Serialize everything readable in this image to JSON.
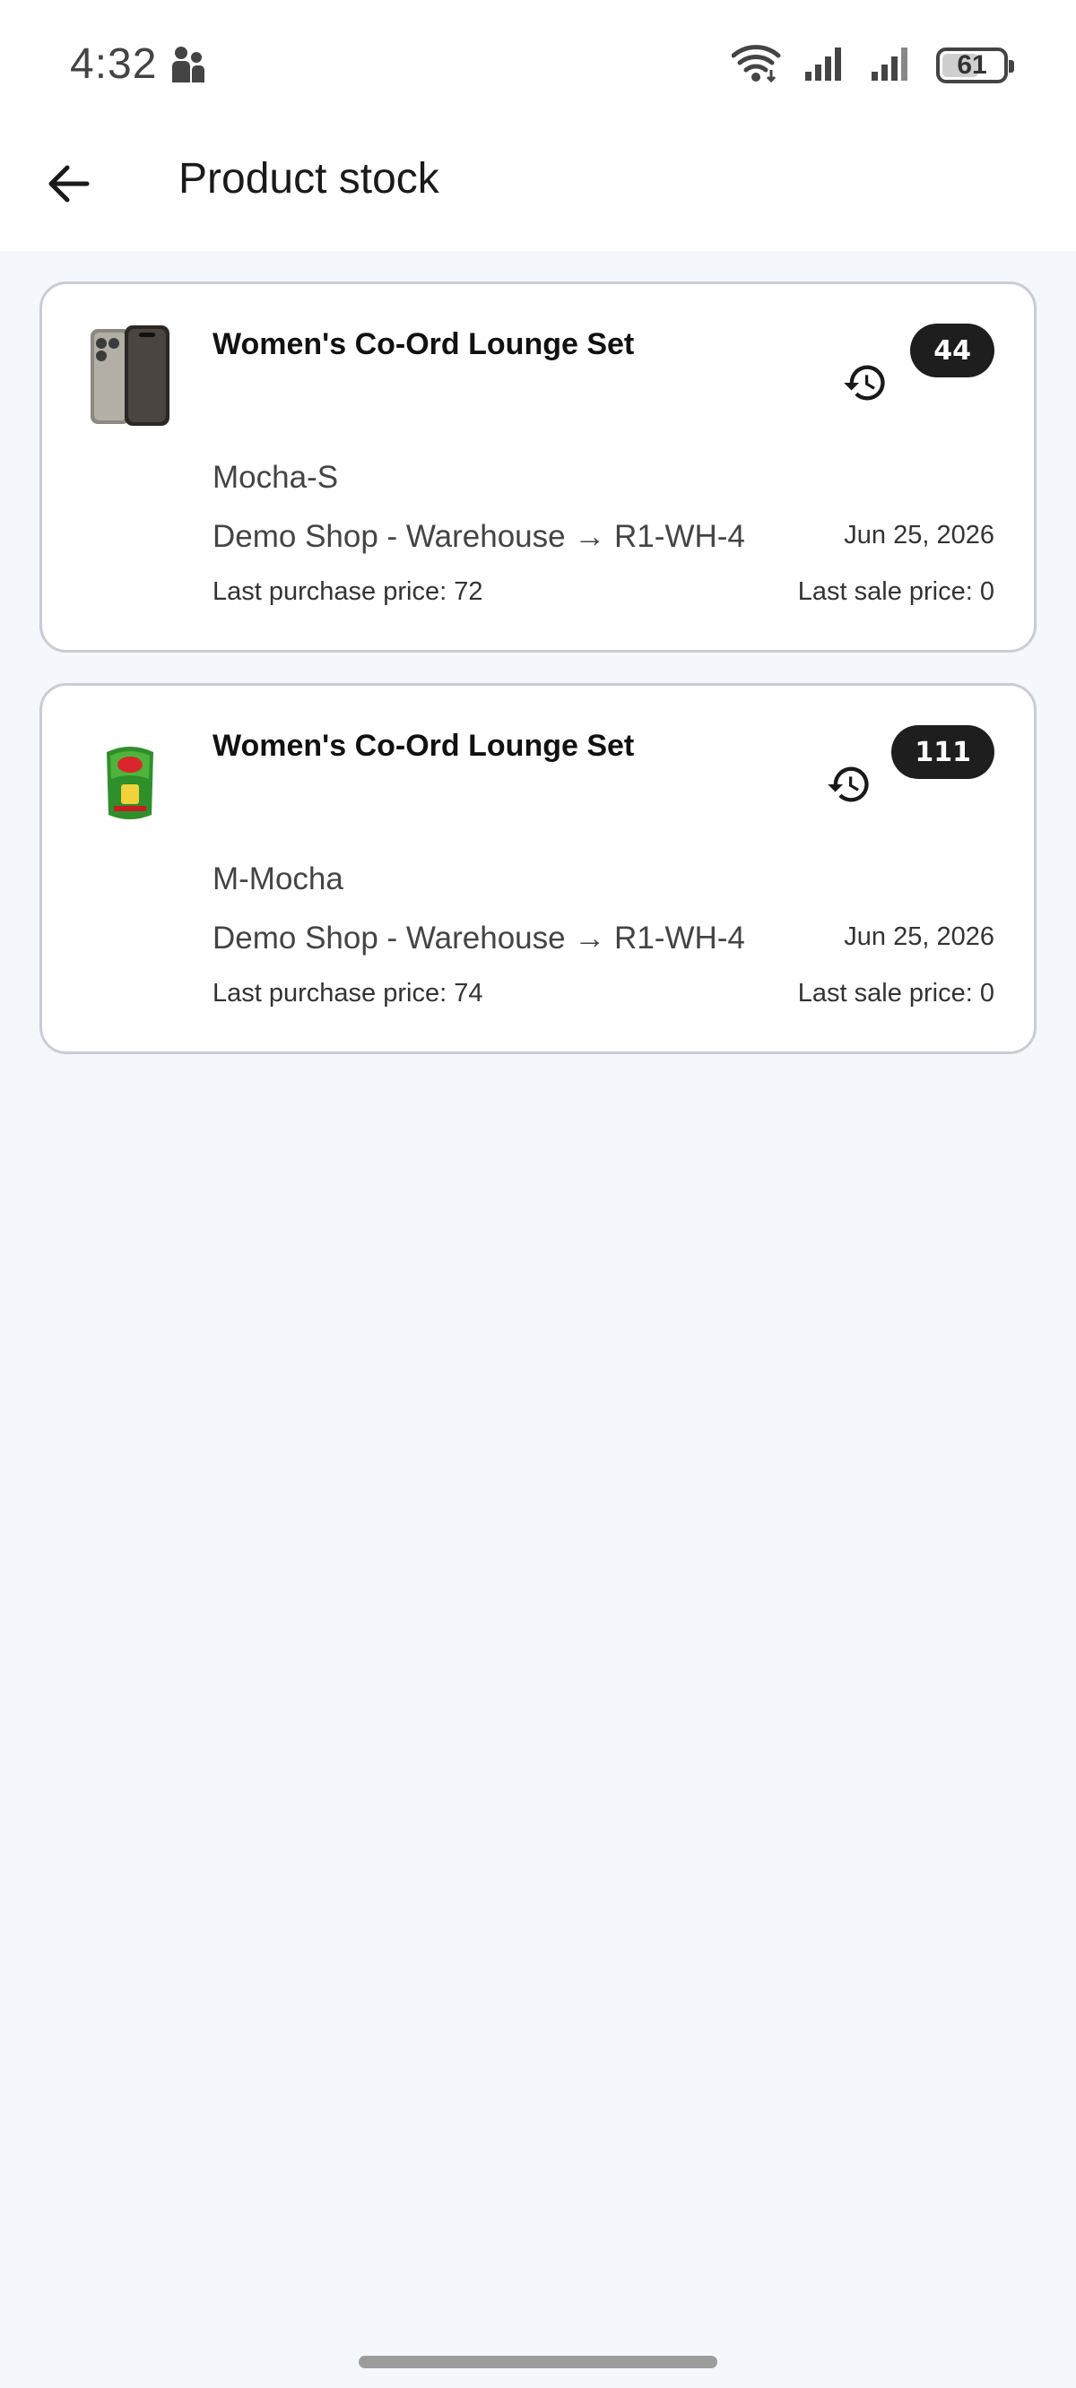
{
  "status_bar": {
    "time": "4:32",
    "battery_level": "61",
    "battery_fraction": 0.61
  },
  "header": {
    "title": "Product stock",
    "back_icon": "arrow-back-icon"
  },
  "items": [
    {
      "name": "Women's Co-Ord Lounge Set",
      "quantity": "44",
      "variant": "Mocha-S",
      "location": "Demo Shop - Warehouse → R1-WH-4",
      "date": "Jun 25, 2026",
      "last_purchase_price": "Last purchase price: 72",
      "last_sale_price": "Last sale price: 0",
      "thumbnail": "phone-product-image",
      "history_icon": "history-icon"
    },
    {
      "name": "Women's Co-Ord Lounge Set",
      "quantity": "111",
      "variant": "M-Mocha",
      "location": "Demo Shop - Warehouse → R1-WH-4",
      "date": "Jun 25, 2026",
      "last_purchase_price": "Last purchase price: 74",
      "last_sale_price": "Last sale price: 0",
      "thumbnail": "green-package-product-image",
      "history_icon": "history-icon"
    }
  ],
  "colors": {
    "background": "#f4f7fc",
    "card_border": "#c9ccd2",
    "badge": "#1e1e1e"
  }
}
